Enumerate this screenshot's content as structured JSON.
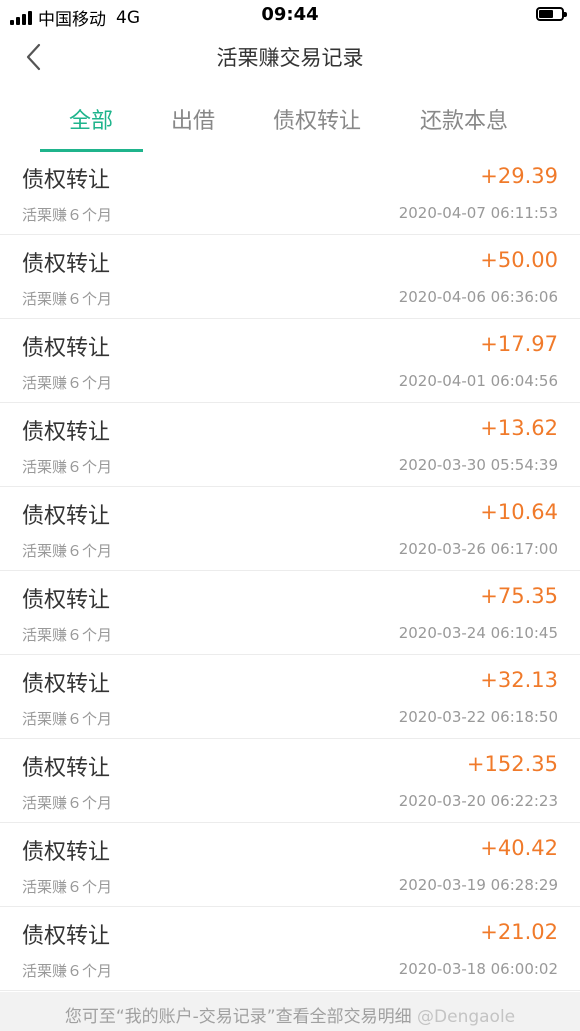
{
  "status_bar": {
    "carrier": "中国移动",
    "network": "4G",
    "time": "09:44"
  },
  "nav": {
    "title": "活栗赚交易记录"
  },
  "tabs": [
    {
      "label": "全部",
      "active": true
    },
    {
      "label": "出借",
      "active": false
    },
    {
      "label": "债权转让",
      "active": false
    },
    {
      "label": "还款本息",
      "active": false
    }
  ],
  "records": [
    {
      "type": "债权转让",
      "amount": "+29.39",
      "product": "活栗赚６个月",
      "time": "2020-04-07 06:11:53"
    },
    {
      "type": "债权转让",
      "amount": "+50.00",
      "product": "活栗赚６个月",
      "time": "2020-04-06 06:36:06"
    },
    {
      "type": "债权转让",
      "amount": "+17.97",
      "product": "活栗赚６个月",
      "time": "2020-04-01 06:04:56"
    },
    {
      "type": "债权转让",
      "amount": "+13.62",
      "product": "活栗赚６个月",
      "time": "2020-03-30 05:54:39"
    },
    {
      "type": "债权转让",
      "amount": "+10.64",
      "product": "活栗赚６个月",
      "time": "2020-03-26 06:17:00"
    },
    {
      "type": "债权转让",
      "amount": "+75.35",
      "product": "活栗赚６个月",
      "time": "2020-03-24 06:10:45"
    },
    {
      "type": "债权转让",
      "amount": "+32.13",
      "product": "活栗赚６个月",
      "time": "2020-03-22 06:18:50"
    },
    {
      "type": "债权转让",
      "amount": "+152.35",
      "product": "活栗赚６个月",
      "time": "2020-03-20 06:22:23"
    },
    {
      "type": "债权转让",
      "amount": "+40.42",
      "product": "活栗赚６个月",
      "time": "2020-03-19 06:28:29"
    },
    {
      "type": "债权转让",
      "amount": "+21.02",
      "product": "活栗赚６个月",
      "time": "2020-03-18 06:00:02"
    }
  ],
  "footer": {
    "note": "您可至“我的账户-交易记录”查看全部交易明细",
    "watermark": "@Dengaole"
  },
  "colors": {
    "accent": "#1fb48c",
    "amount": "#f07a2a"
  },
  "icons": {
    "back": "chevron-left-icon",
    "signal": "signal-icon",
    "battery": "battery-icon"
  }
}
